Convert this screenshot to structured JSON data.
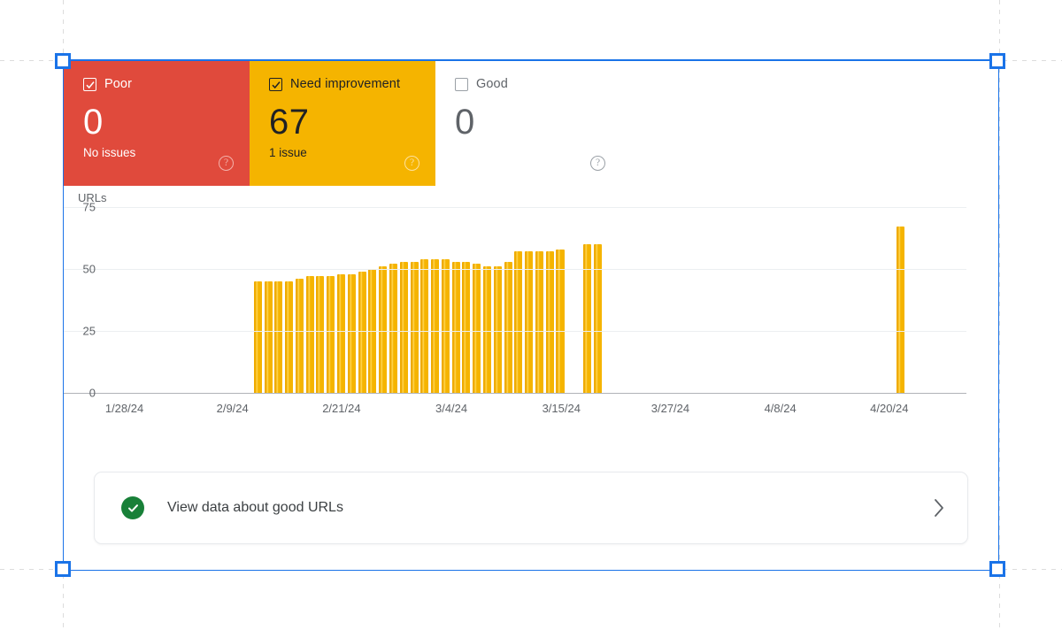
{
  "colors": {
    "poor": "#E04A3C",
    "need_improvement": "#F5B400",
    "good": "#FFFFFF",
    "selection": "#1A73E8",
    "bar": "#F5B400",
    "success": "#188038"
  },
  "cards": [
    {
      "id": "poor",
      "label": "Poor",
      "checked": true,
      "value": "0",
      "subtitle": "No issues",
      "help_icon": "help-circle-icon",
      "checkbox_icon": "checkbox-checked-icon"
    },
    {
      "id": "need-improvement",
      "label": "Need improvement",
      "checked": true,
      "value": "67",
      "subtitle": "1 issue",
      "help_icon": "help-circle-icon",
      "checkbox_icon": "checkbox-checked-icon"
    },
    {
      "id": "good",
      "label": "Good",
      "checked": false,
      "value": "0",
      "subtitle": "",
      "help_icon": "help-circle-icon",
      "checkbox_icon": "checkbox-unchecked-icon"
    }
  ],
  "banner": {
    "icon": "check-circle-icon",
    "text": "View data about good URLs",
    "chevron": "chevron-right-icon"
  },
  "chart_data": {
    "type": "bar",
    "title": "",
    "ylabel": "URLs",
    "xlabel": "",
    "ylim": [
      0,
      75
    ],
    "yticks": [
      0,
      25,
      50,
      75
    ],
    "ytick_labels": [
      "0",
      "25",
      "50",
      "75"
    ],
    "grid": true,
    "legend": false,
    "xtick_labels": [
      "1/28/24",
      "2/9/24",
      "2/21/24",
      "3/4/24",
      "3/15/24",
      "3/27/24",
      "4/8/24",
      "4/20/24"
    ],
    "xtick_positions_pct": [
      3.0,
      15.0,
      27.1,
      39.3,
      51.5,
      63.6,
      75.8,
      87.9
    ],
    "series_name": "Need improvement",
    "series_color": "#F5B400",
    "x": [
      "2/14/24",
      "2/15/24",
      "2/16/24",
      "2/17/24",
      "2/18/24",
      "2/19/24",
      "2/20/24",
      "2/21/24",
      "2/22/24",
      "2/23/24",
      "2/24/24",
      "2/25/24",
      "2/26/24",
      "2/27/24",
      "2/28/24",
      "2/29/24",
      "3/1/24",
      "3/2/24",
      "3/3/24",
      "3/4/24",
      "3/5/24",
      "3/6/24",
      "3/7/24",
      "3/8/24",
      "3/9/24",
      "3/10/24",
      "3/11/24",
      "3/12/24",
      "3/13/24",
      "3/14/24",
      "3/16/24",
      "3/17/24",
      "4/26/24"
    ],
    "values": [
      45,
      45,
      45,
      45,
      46,
      47,
      47,
      47,
      48,
      48,
      49,
      50,
      51,
      52,
      53,
      53,
      54,
      54,
      54,
      53,
      53,
      52,
      51,
      51,
      53,
      57,
      57,
      57,
      57,
      58,
      60,
      60,
      67
    ],
    "bar_positions_pct": [
      18.0,
      19.2,
      20.4,
      21.6,
      22.8,
      24.0,
      25.2,
      26.4,
      27.6,
      28.8,
      30.0,
      31.2,
      32.4,
      33.6,
      34.8,
      36.0,
      37.2,
      38.4,
      39.6,
      40.8,
      42.0,
      43.2,
      44.4,
      45.6,
      46.8,
      48.0,
      49.2,
      50.4,
      51.6,
      52.8,
      55.9,
      57.1,
      92.0
    ]
  }
}
